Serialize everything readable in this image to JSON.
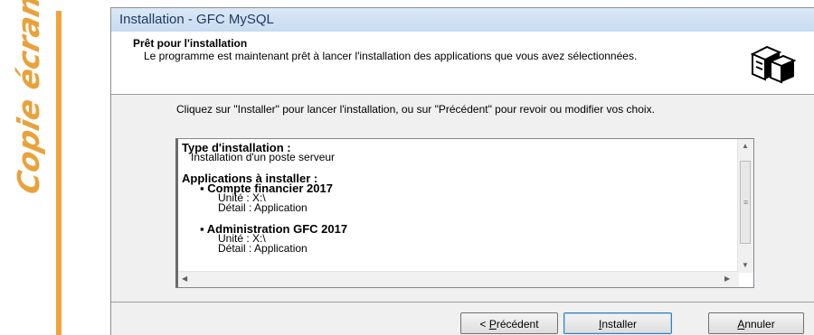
{
  "side_label": "Copie écran",
  "window": {
    "title": "Installation - GFC MySQL"
  },
  "header": {
    "title": "Prêt pour l'installation",
    "description": "Le programme est maintenant prêt à lancer l'installation des applications que vous avez sélectionnées.",
    "icon": "computer-disk-icon"
  },
  "instructions": "Cliquez sur \"Installer\" pour lancer l'installation, ou sur \"Précédent\" pour revoir ou modifier vos choix.",
  "summary": {
    "install_type_heading": "Type d'installation :",
    "install_type_value": "Installation d'un poste serveur",
    "apps_heading": "Applications à installer :",
    "apps": [
      {
        "name": "Compte financier 2017",
        "unit": "Unité : X:\\",
        "detail": "Détail : Application"
      },
      {
        "name": "Administration GFC 2017",
        "unit": "Unité : X:\\",
        "detail": "Détail : Application"
      }
    ]
  },
  "buttons": {
    "back": {
      "prefix": "< ",
      "mnemonic": "P",
      "rest": "récédent"
    },
    "install": {
      "mnemonic": "I",
      "rest": "nstaller"
    },
    "cancel": {
      "mnemonic": "A",
      "rest": "nnuler"
    }
  },
  "colors": {
    "accent": "#f0a33a",
    "title_bar": "#c7dbf1",
    "window_bg": "#f0f0f0"
  }
}
